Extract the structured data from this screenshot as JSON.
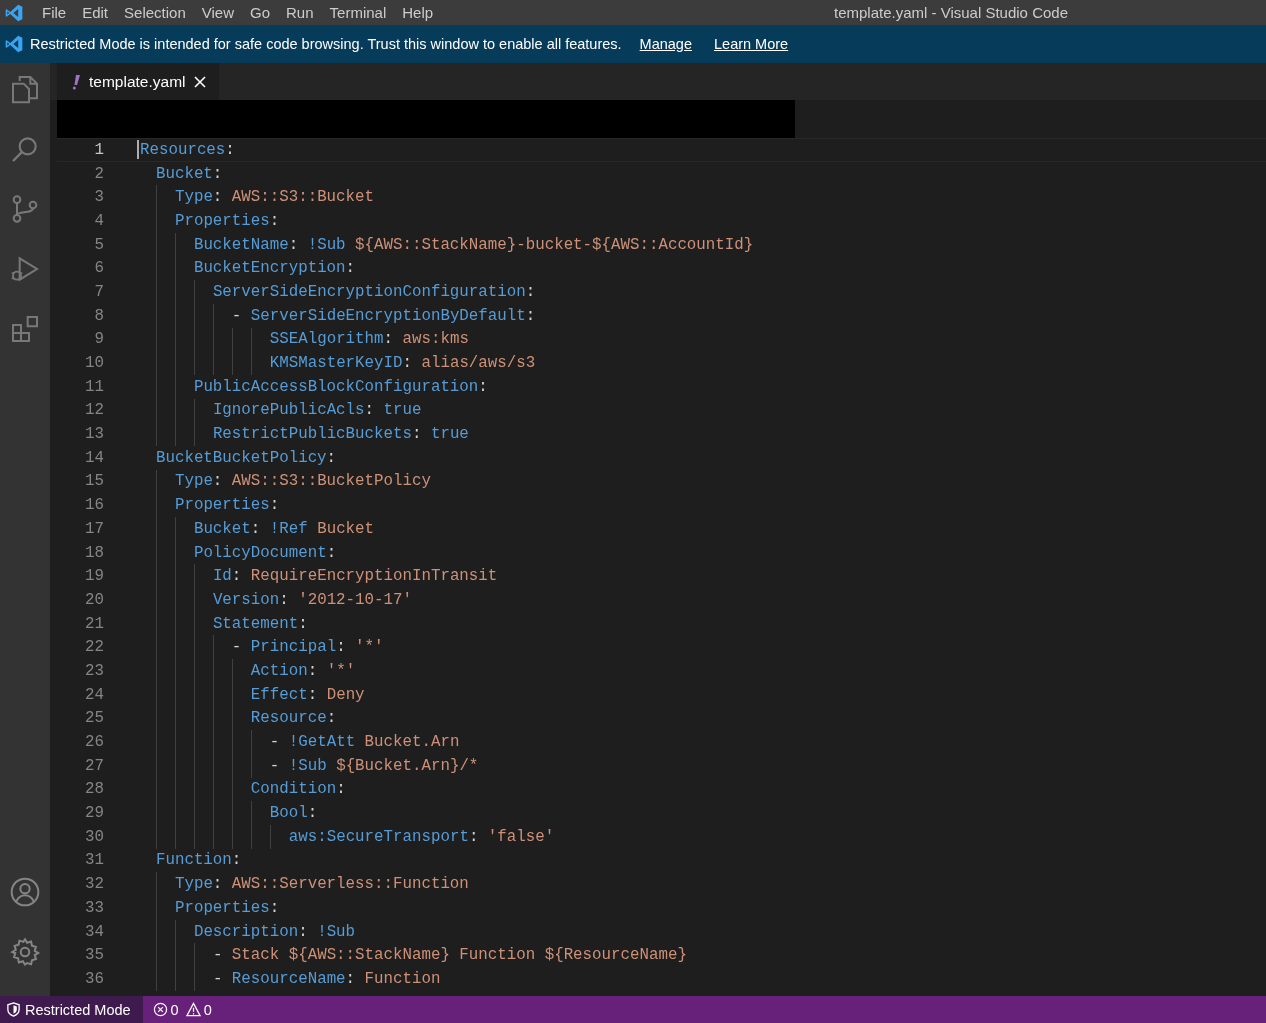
{
  "window": {
    "title": "template.yaml - Visual Studio Code"
  },
  "menu": [
    "File",
    "Edit",
    "Selection",
    "View",
    "Go",
    "Run",
    "Terminal",
    "Help"
  ],
  "banner": {
    "message": "Restricted Mode is intended for safe code browsing. Trust this window to enable all features.",
    "links": [
      "Manage",
      "Learn More"
    ]
  },
  "activity_bar": {
    "top": [
      {
        "kind": "files",
        "selected": false
      },
      {
        "kind": "search",
        "selected": false
      },
      {
        "kind": "source-control",
        "selected": false
      },
      {
        "kind": "run",
        "selected": false
      },
      {
        "kind": "extensions",
        "selected": false
      }
    ],
    "bottom": [
      {
        "kind": "account"
      },
      {
        "kind": "settings"
      }
    ]
  },
  "tabs": [
    {
      "label": "template.yaml",
      "selected": true
    }
  ],
  "editor": {
    "lines": [
      {
        "number": "1",
        "current": true,
        "tokens": [
          {
            "kind": "key",
            "text": "Resources"
          },
          {
            "kind": "punct",
            "text": ":"
          }
        ]
      },
      {
        "number": "2",
        "current": false,
        "tokens": [
          {
            "kind": "key",
            "text": "  Bucket"
          },
          {
            "kind": "punct",
            "text": ":"
          }
        ]
      },
      {
        "number": "3",
        "current": false,
        "tokens": [
          {
            "kind": "key",
            "text": "    Type"
          },
          {
            "kind": "punct",
            "text": ": "
          },
          {
            "kind": "string",
            "text": "AWS::S3::Bucket"
          }
        ]
      },
      {
        "number": "4",
        "current": false,
        "tokens": [
          {
            "kind": "key",
            "text": "    Properties"
          },
          {
            "kind": "punct",
            "text": ":"
          }
        ]
      },
      {
        "number": "5",
        "current": false,
        "tokens": [
          {
            "kind": "key",
            "text": "      BucketName"
          },
          {
            "kind": "punct",
            "text": ": "
          },
          {
            "kind": "tag",
            "text": "!Sub "
          },
          {
            "kind": "string",
            "text": "${AWS::StackName}-bucket-${AWS::AccountId}"
          }
        ]
      },
      {
        "number": "6",
        "current": false,
        "tokens": [
          {
            "kind": "key",
            "text": "      BucketEncryption"
          },
          {
            "kind": "punct",
            "text": ":"
          }
        ]
      },
      {
        "number": "7",
        "current": false,
        "tokens": [
          {
            "kind": "key",
            "text": "        ServerSideEncryptionConfiguration"
          },
          {
            "kind": "punct",
            "text": ":"
          }
        ]
      },
      {
        "number": "8",
        "current": false,
        "tokens": [
          {
            "kind": "punct",
            "text": "          - "
          },
          {
            "kind": "key",
            "text": "ServerSideEncryptionByDefault"
          },
          {
            "kind": "punct",
            "text": ":"
          }
        ]
      },
      {
        "number": "9",
        "current": false,
        "tokens": [
          {
            "kind": "key",
            "text": "              SSEAlgorithm"
          },
          {
            "kind": "punct",
            "text": ": "
          },
          {
            "kind": "string",
            "text": "aws:kms"
          }
        ]
      },
      {
        "number": "10",
        "current": false,
        "tokens": [
          {
            "kind": "key",
            "text": "              KMSMasterKeyID"
          },
          {
            "kind": "punct",
            "text": ": "
          },
          {
            "kind": "string",
            "text": "alias/aws/s3"
          }
        ]
      },
      {
        "number": "11",
        "current": false,
        "tokens": [
          {
            "kind": "key",
            "text": "      PublicAccessBlockConfiguration"
          },
          {
            "kind": "punct",
            "text": ":"
          }
        ]
      },
      {
        "number": "12",
        "current": false,
        "tokens": [
          {
            "kind": "key",
            "text": "        IgnorePublicAcls"
          },
          {
            "kind": "punct",
            "text": ": "
          },
          {
            "kind": "bool",
            "text": "true"
          }
        ]
      },
      {
        "number": "13",
        "current": false,
        "tokens": [
          {
            "kind": "key",
            "text": "        RestrictPublicBuckets"
          },
          {
            "kind": "punct",
            "text": ": "
          },
          {
            "kind": "bool",
            "text": "true"
          }
        ]
      },
      {
        "number": "14",
        "current": false,
        "tokens": [
          {
            "kind": "key",
            "text": "  BucketBucketPolicy"
          },
          {
            "kind": "punct",
            "text": ":"
          }
        ]
      },
      {
        "number": "15",
        "current": false,
        "tokens": [
          {
            "kind": "key",
            "text": "    Type"
          },
          {
            "kind": "punct",
            "text": ": "
          },
          {
            "kind": "string",
            "text": "AWS::S3::BucketPolicy"
          }
        ]
      },
      {
        "number": "16",
        "current": false,
        "tokens": [
          {
            "kind": "key",
            "text": "    Properties"
          },
          {
            "kind": "punct",
            "text": ":"
          }
        ]
      },
      {
        "number": "17",
        "current": false,
        "tokens": [
          {
            "kind": "key",
            "text": "      Bucket"
          },
          {
            "kind": "punct",
            "text": ": "
          },
          {
            "kind": "tag",
            "text": "!Ref "
          },
          {
            "kind": "string",
            "text": "Bucket"
          }
        ]
      },
      {
        "number": "18",
        "current": false,
        "tokens": [
          {
            "kind": "key",
            "text": "      PolicyDocument"
          },
          {
            "kind": "punct",
            "text": ":"
          }
        ]
      },
      {
        "number": "19",
        "current": false,
        "tokens": [
          {
            "kind": "key",
            "text": "        Id"
          },
          {
            "kind": "punct",
            "text": ": "
          },
          {
            "kind": "string",
            "text": "RequireEncryptionInTransit"
          }
        ]
      },
      {
        "number": "20",
        "current": false,
        "tokens": [
          {
            "kind": "key",
            "text": "        Version"
          },
          {
            "kind": "punct",
            "text": ": "
          },
          {
            "kind": "string",
            "text": "'2012-10-17'"
          }
        ]
      },
      {
        "number": "21",
        "current": false,
        "tokens": [
          {
            "kind": "key",
            "text": "        Statement"
          },
          {
            "kind": "punct",
            "text": ":"
          }
        ]
      },
      {
        "number": "22",
        "current": false,
        "tokens": [
          {
            "kind": "punct",
            "text": "          - "
          },
          {
            "kind": "key",
            "text": "Principal"
          },
          {
            "kind": "punct",
            "text": ": "
          },
          {
            "kind": "string",
            "text": "'*'"
          }
        ]
      },
      {
        "number": "23",
        "current": false,
        "tokens": [
          {
            "kind": "key",
            "text": "            Action"
          },
          {
            "kind": "punct",
            "text": ": "
          },
          {
            "kind": "string",
            "text": "'*'"
          }
        ]
      },
      {
        "number": "24",
        "current": false,
        "tokens": [
          {
            "kind": "key",
            "text": "            Effect"
          },
          {
            "kind": "punct",
            "text": ": "
          },
          {
            "kind": "string",
            "text": "Deny"
          }
        ]
      },
      {
        "number": "25",
        "current": false,
        "tokens": [
          {
            "kind": "key",
            "text": "            Resource"
          },
          {
            "kind": "punct",
            "text": ":"
          }
        ]
      },
      {
        "number": "26",
        "current": false,
        "tokens": [
          {
            "kind": "punct",
            "text": "              - "
          },
          {
            "kind": "tag",
            "text": "!GetAtt "
          },
          {
            "kind": "string",
            "text": "Bucket.Arn"
          }
        ]
      },
      {
        "number": "27",
        "current": false,
        "tokens": [
          {
            "kind": "punct",
            "text": "              - "
          },
          {
            "kind": "tag",
            "text": "!Sub "
          },
          {
            "kind": "string",
            "text": "${Bucket.Arn}/*"
          }
        ]
      },
      {
        "number": "28",
        "current": false,
        "tokens": [
          {
            "kind": "key",
            "text": "            Condition"
          },
          {
            "kind": "punct",
            "text": ":"
          }
        ]
      },
      {
        "number": "29",
        "current": false,
        "tokens": [
          {
            "kind": "key",
            "text": "              Bool"
          },
          {
            "kind": "punct",
            "text": ":"
          }
        ]
      },
      {
        "number": "30",
        "current": false,
        "tokens": [
          {
            "kind": "key",
            "text": "                aws:SecureTransport"
          },
          {
            "kind": "punct",
            "text": ": "
          },
          {
            "kind": "string",
            "text": "'false'"
          }
        ]
      },
      {
        "number": "31",
        "current": false,
        "tokens": [
          {
            "kind": "key",
            "text": "  Function"
          },
          {
            "kind": "punct",
            "text": ":"
          }
        ]
      },
      {
        "number": "32",
        "current": false,
        "tokens": [
          {
            "kind": "key",
            "text": "    Type"
          },
          {
            "kind": "punct",
            "text": ": "
          },
          {
            "kind": "string",
            "text": "AWS::Serverless::Function"
          }
        ]
      },
      {
        "number": "33",
        "current": false,
        "tokens": [
          {
            "kind": "key",
            "text": "    Properties"
          },
          {
            "kind": "punct",
            "text": ":"
          }
        ]
      },
      {
        "number": "34",
        "current": false,
        "tokens": [
          {
            "kind": "key",
            "text": "      Description"
          },
          {
            "kind": "punct",
            "text": ": "
          },
          {
            "kind": "tag",
            "text": "!Sub"
          }
        ]
      },
      {
        "number": "35",
        "current": false,
        "tokens": [
          {
            "kind": "punct",
            "text": "        - "
          },
          {
            "kind": "string",
            "text": "Stack ${AWS::StackName} Function ${ResourceName}"
          }
        ]
      },
      {
        "number": "36",
        "current": false,
        "tokens": [
          {
            "kind": "punct",
            "text": "        - "
          },
          {
            "kind": "key",
            "text": "ResourceName"
          },
          {
            "kind": "punct",
            "text": ": "
          },
          {
            "kind": "string",
            "text": "Function"
          }
        ]
      }
    ]
  },
  "status_bar": {
    "mode": "Restricted Mode",
    "errors": "0",
    "warnings": "0"
  }
}
